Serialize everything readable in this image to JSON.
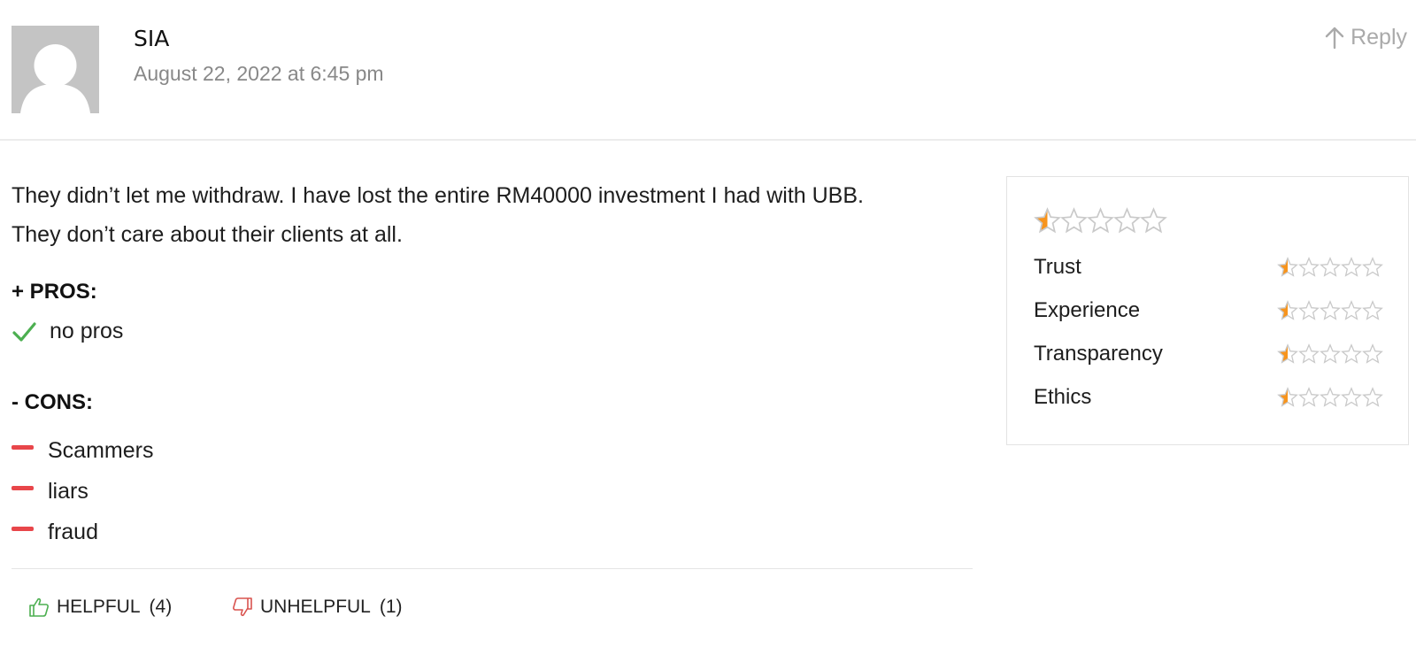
{
  "comment": {
    "author": "SIA",
    "date": "August 22, 2022 at 6:45 pm",
    "reply_label": "Reply",
    "text_lines": [
      "They didn’t let me withdraw. I have lost the entire RM40000 investment I had with UBB.",
      "They don’t care about their clients at all."
    ],
    "pros": {
      "title": "+ PROS:",
      "items": [
        "no pros"
      ]
    },
    "cons": {
      "title": "- CONS:",
      "items": [
        "Scammers",
        "liars",
        "fraud"
      ]
    },
    "votes": {
      "helpful_label": "HELPFUL",
      "helpful_count": "(4)",
      "unhelpful_label": "UNHELPFUL",
      "unhelpful_count": "(1)"
    }
  },
  "ratings": {
    "overall": {
      "value": 0.5,
      "max": 5
    },
    "categories": [
      {
        "label": "Trust",
        "value": 0.5,
        "max": 5
      },
      {
        "label": "Experience",
        "value": 0.5,
        "max": 5
      },
      {
        "label": "Transparency",
        "value": 0.5,
        "max": 5
      },
      {
        "label": "Ethics",
        "value": 0.5,
        "max": 5
      }
    ]
  },
  "icons": {
    "avatar": "default-user-avatar",
    "reply": "arrow-up-icon",
    "pros_item": "check-icon",
    "cons_item": "minus-icon",
    "helpful": "thumbs-up-icon",
    "unhelpful": "thumbs-down-icon",
    "star": "star-icon"
  },
  "colors": {
    "star_fill": "#f7941d",
    "star_empty": "#c9c9c9",
    "check": "#4caf50",
    "minus": "#e8464a",
    "thumb_up": "#4caf50",
    "thumb_down": "#d9534f",
    "muted_text": "#888888"
  }
}
